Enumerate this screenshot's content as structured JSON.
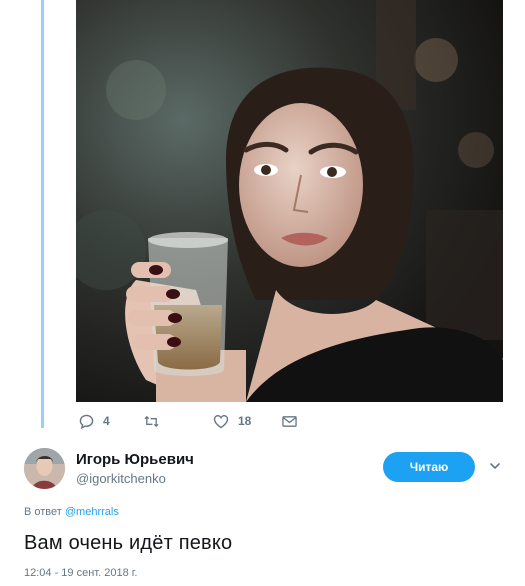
{
  "tweet": {
    "actions": {
      "reply_count": "4",
      "retweet_count": "",
      "like_count": "18"
    },
    "author": {
      "name": "Игорь Юрьевич",
      "handle": "@igorkitchenko"
    },
    "follow_label": "Читаю",
    "reply_prefix": "В ответ",
    "reply_mention": "@mehrrals",
    "text": "Вам очень идёт певко",
    "timestamp": "12:04 - 19 сент. 2018 г."
  },
  "icons": {
    "reply": "reply-icon",
    "retweet": "retweet-icon",
    "like": "heart-icon",
    "message": "envelope-icon",
    "more": "chevron-down-icon"
  },
  "colors": {
    "accent": "#1da1f2",
    "thread_line": "#9ad0f5",
    "muted": "#657786"
  }
}
